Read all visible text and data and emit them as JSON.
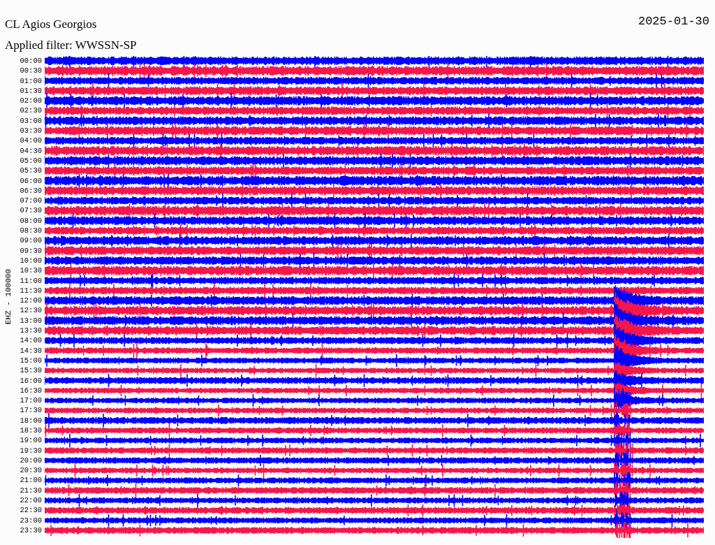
{
  "header": {
    "station": "CL Agios Georgios",
    "filter": "Applied filter: WWSSN-SP",
    "date": "2025-01-30"
  },
  "axis_label": "EHZ - 100000",
  "rows": [
    {
      "time": "00:00",
      "color": "#0000ff"
    },
    {
      "time": "00:30",
      "color": "#f5164a"
    },
    {
      "time": "01:00",
      "color": "#0000ff"
    },
    {
      "time": "01:30",
      "color": "#f5164a"
    },
    {
      "time": "02:00",
      "color": "#0000ff"
    },
    {
      "time": "02:30",
      "color": "#f5164a"
    },
    {
      "time": "03:00",
      "color": "#0000ff"
    },
    {
      "time": "03:30",
      "color": "#f5164a"
    },
    {
      "time": "04:00",
      "color": "#0000ff"
    },
    {
      "time": "04:30",
      "color": "#f5164a"
    },
    {
      "time": "05:00",
      "color": "#0000ff"
    },
    {
      "time": "05:30",
      "color": "#f5164a"
    },
    {
      "time": "06:00",
      "color": "#0000ff"
    },
    {
      "time": "06:30",
      "color": "#f5164a"
    },
    {
      "time": "07:00",
      "color": "#0000ff"
    },
    {
      "time": "07:30",
      "color": "#f5164a"
    },
    {
      "time": "08:00",
      "color": "#0000ff"
    },
    {
      "time": "08:30",
      "color": "#f5164a"
    },
    {
      "time": "09:00",
      "color": "#0000ff"
    },
    {
      "time": "09:30",
      "color": "#f5164a"
    },
    {
      "time": "10:00",
      "color": "#0000ff"
    },
    {
      "time": "10:30",
      "color": "#f5164a"
    },
    {
      "time": "11:00",
      "color": "#0000ff"
    },
    {
      "time": "11:30",
      "color": "#f5164a"
    },
    {
      "time": "12:00",
      "color": "#0000ff"
    },
    {
      "time": "12:30",
      "color": "#f5164a"
    },
    {
      "time": "13:00",
      "color": "#0000ff"
    },
    {
      "time": "13:30",
      "color": "#f5164a"
    },
    {
      "time": "14:00",
      "color": "#0000ff"
    },
    {
      "time": "14:30",
      "color": "#f5164a"
    },
    {
      "time": "15:00",
      "color": "#0000ff"
    },
    {
      "time": "15:30",
      "color": "#f5164a"
    },
    {
      "time": "16:00",
      "color": "#0000ff"
    },
    {
      "time": "16:30",
      "color": "#f5164a"
    },
    {
      "time": "17:00",
      "color": "#0000ff"
    },
    {
      "time": "17:30",
      "color": "#f5164a"
    },
    {
      "time": "18:00",
      "color": "#0000ff"
    },
    {
      "time": "18:30",
      "color": "#f5164a"
    },
    {
      "time": "19:00",
      "color": "#0000ff"
    },
    {
      "time": "19:30",
      "color": "#f5164a"
    },
    {
      "time": "20:00",
      "color": "#0000ff"
    },
    {
      "time": "20:30",
      "color": "#f5164a"
    },
    {
      "time": "21:00",
      "color": "#0000ff"
    },
    {
      "time": "21:30",
      "color": "#f5164a"
    },
    {
      "time": "22:00",
      "color": "#0000ff"
    },
    {
      "time": "22:30",
      "color": "#f5164a"
    },
    {
      "time": "23:00",
      "color": "#0000ff"
    },
    {
      "time": "23:30",
      "color": "#f5164a"
    }
  ]
}
